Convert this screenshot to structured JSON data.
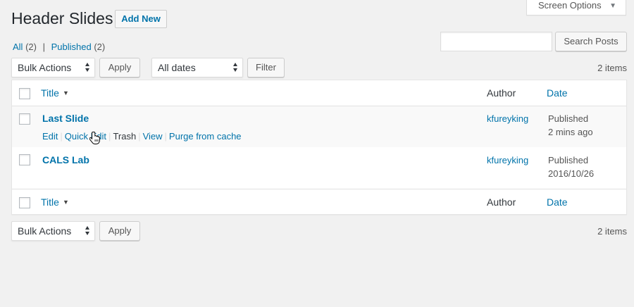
{
  "page": {
    "title": "Header Slides",
    "add_new_label": "Add New",
    "screen_options_label": "Screen Options"
  },
  "filters": {
    "all_label": "All",
    "all_count": "(2)",
    "published_label": "Published",
    "published_count": "(2)",
    "separator": "|"
  },
  "search": {
    "input_value": "",
    "button_label": "Search Posts"
  },
  "top_nav": {
    "bulk_actions": "Bulk Actions",
    "apply_label": "Apply",
    "dates": "All dates",
    "filter_label": "Filter",
    "items_count": "2 items"
  },
  "bottom_nav": {
    "bulk_actions": "Bulk Actions",
    "apply_label": "Apply",
    "items_count": "2 items"
  },
  "table": {
    "columns": {
      "title": "Title",
      "author": "Author",
      "date": "Date"
    },
    "rows": [
      {
        "title": "Last Slide",
        "author": "kfureyking",
        "status": "Published",
        "date": "2 mins ago",
        "actions": {
          "edit": "Edit",
          "quick_edit": "Quick Edit",
          "trash": "Trash",
          "view": "View",
          "purge": "Purge from cache"
        }
      },
      {
        "title": "CALS Lab",
        "author": "kfureyking",
        "status": "Published",
        "date": "2016/10/26"
      }
    ]
  },
  "icons": {
    "sort": "caret-down-icon",
    "screen_options": "caret-down-icon",
    "cursor": "hand-pointer-icon"
  }
}
